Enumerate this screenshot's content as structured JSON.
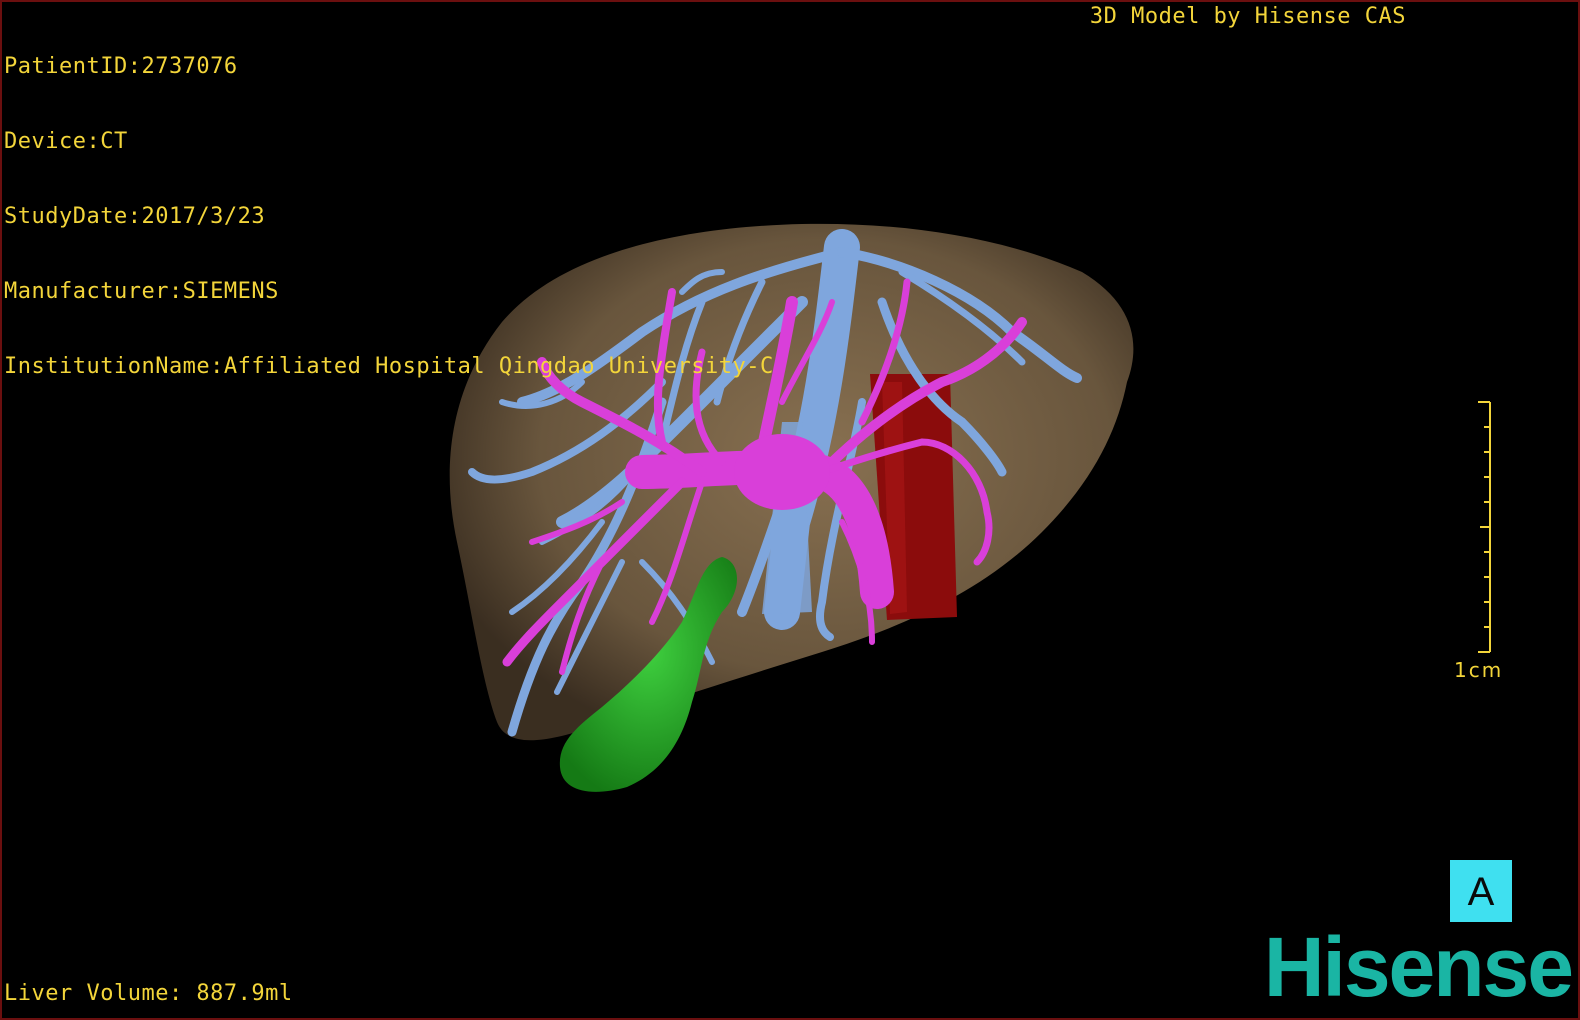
{
  "overlay": {
    "patient_id": "PatientID:2737076",
    "device": "Device:CT",
    "study_date": "StudyDate:2017/3/23",
    "manufacturer": "Manufacturer:SIEMENS",
    "institution": "InstitutionName:Affiliated Hospital Qingdao University-C",
    "credit": "3D Model by Hisense CAS",
    "liver_volume": "Liver Volume: 887.9ml"
  },
  "scale_bar": {
    "label": "1cm"
  },
  "orientation_marker": {
    "label": "A"
  },
  "brand": {
    "logo_text": "Hisense"
  },
  "colors": {
    "overlay_text": "#f3d53a",
    "liver": "#8a7050",
    "hepatic_vein": "#7fa6dd",
    "portal_vein": "#d93fd9",
    "inferior_vena_cava": "#8b0c0c",
    "gallbladder": "#22b322",
    "orientation_box": "#3fe0f0",
    "logo": "#1ab5a4"
  }
}
